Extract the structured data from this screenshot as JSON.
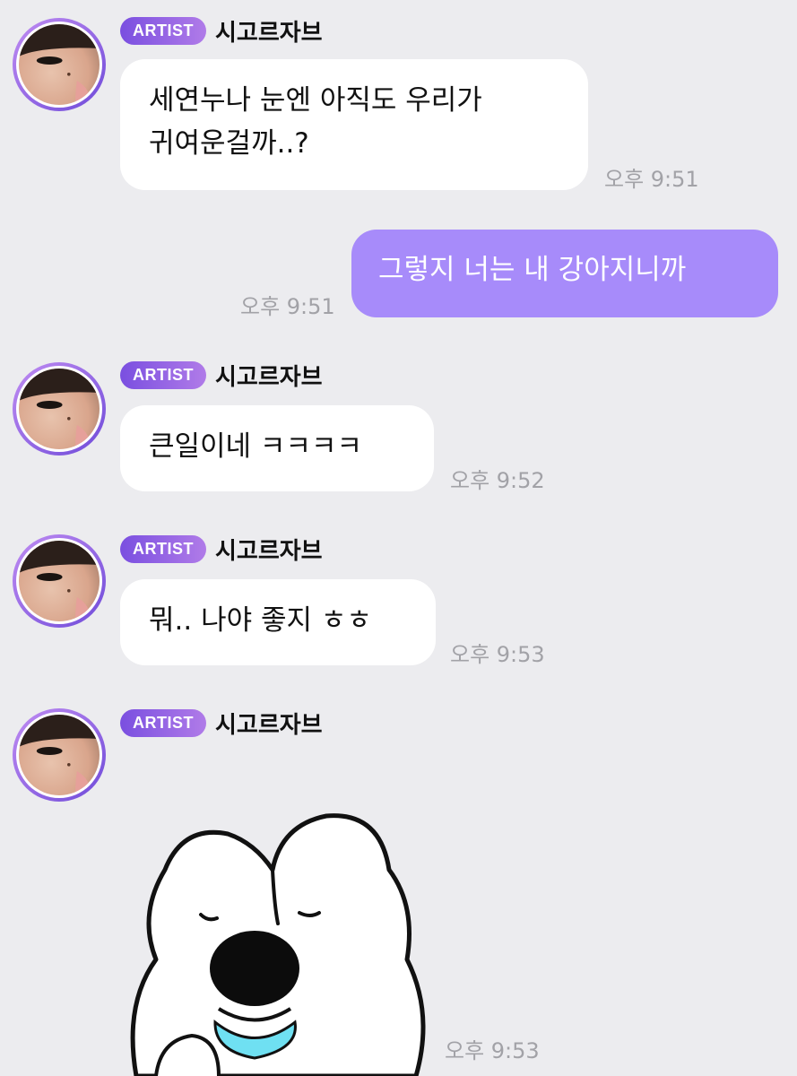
{
  "artist_badge": "ARTIST",
  "artist_name": "시고르자브",
  "messages": [
    {
      "line1": "세연누나 눈엔 아직도 우리가",
      "line2": "귀여운걸까..?",
      "time": "오후 9:51"
    },
    {
      "text": "그렇지 너는 내 강아지니까",
      "time": "오후 9:51"
    },
    {
      "text": "큰일이네 ㅋㅋㅋㅋ",
      "time": "오후 9:52"
    },
    {
      "text": "뭐.. 나야 좋지 ㅎㅎ",
      "time": "오후 9:53"
    },
    {
      "time": "오후 9:53"
    }
  ],
  "colors": {
    "background": "#ececef",
    "my_bubble": "#a78bfa",
    "badge_gradient_start": "#7a4fe0",
    "badge_gradient_end": "#b07be8"
  },
  "icons": [
    "avatar-photo",
    "dog-sticker"
  ]
}
